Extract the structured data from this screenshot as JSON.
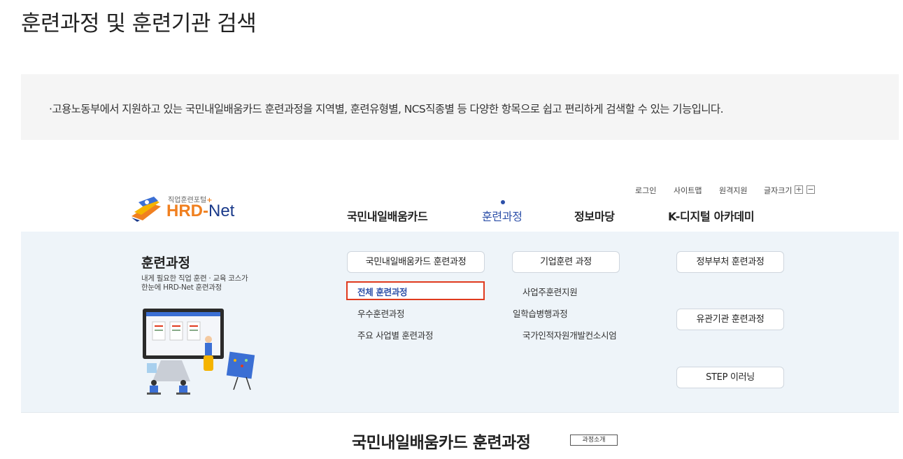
{
  "page": {
    "title": "훈련과정 및 훈련기관 검색",
    "description": "·고용노동부에서 지원하고 있는 국민내일배움카드 훈련과정을 지역별, 훈련유형별, NCS직종별 등 다양한 항목으로 쉽고 편리하게 검색할 수 있는 기능입니다."
  },
  "header": {
    "util": {
      "login": "로그인",
      "sitemap": "사이트맵",
      "remote": "원격지원",
      "font_size": "글자크기",
      "font_plus": "+",
      "font_minus": "−"
    },
    "logo": {
      "sub": "직업훈련포털",
      "plus": "+",
      "hrd": "HRD",
      "dash": "-",
      "net": "Net"
    },
    "gnb": [
      {
        "label": "국민내일배움카드"
      },
      {
        "label": "훈련과정"
      },
      {
        "label": "정보마당"
      },
      {
        "label": "K-디지털 아카데미"
      }
    ]
  },
  "mega": {
    "title": "훈련과정",
    "desc_line1": "내게 필요한 직업 훈련 · 교육 코스가",
    "desc_line2": "한눈에 HRD-Net 훈련과정",
    "col1": {
      "header": "국민내일배움카드 훈련과정",
      "items": [
        "전체 훈련과정",
        "우수훈련과정",
        "주요 사업별 훈련과정"
      ]
    },
    "col2": {
      "header": "기업훈련 과정",
      "items": [
        "사업주훈련지원",
        "일학습병행과정",
        "국가인적자원개발컨소시엄"
      ]
    },
    "col3": {
      "items": [
        "정부부처 훈련과정",
        "유관기관 훈련과정",
        "STEP 이러닝"
      ]
    }
  },
  "section": {
    "title": "국민내일배움카드 훈련과정",
    "tag": "과정소개"
  },
  "colors": {
    "accent": "#2c4fa8",
    "logo_orange": "#f08020",
    "highlight": "#e03a1e",
    "mega_bg": "#eef4f9"
  }
}
